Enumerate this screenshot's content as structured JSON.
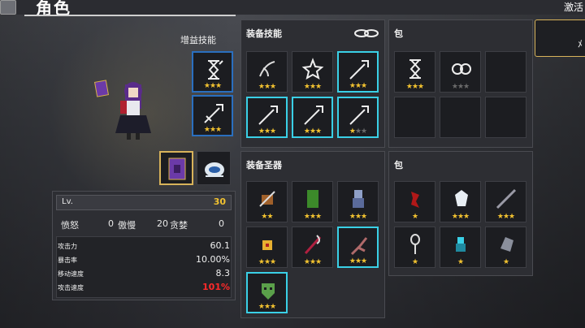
{
  "header": {
    "title": "角色",
    "activate": "激活"
  },
  "buff_skills": {
    "label": "增益技能"
  },
  "equip_skills": {
    "title": "装备技能"
  },
  "bag_top": {
    "title": "包"
  },
  "equip_relics": {
    "title": "装备圣器"
  },
  "bag_bottom": {
    "title": "包"
  },
  "stats": {
    "lv_label": "Lv.",
    "lv_value": "30",
    "anger_label": "愤怒",
    "anger_value": "0",
    "pride_label": "傲慢",
    "pride_value": "20",
    "greed_label": "贪婪",
    "greed_value": "0",
    "rows": [
      {
        "label": "攻击力",
        "value": "60.1"
      },
      {
        "label": "暴击率",
        "value": "10.00%"
      },
      {
        "label": "移动速度",
        "value": "8.3"
      },
      {
        "label": "攻击速度",
        "value": "101%"
      }
    ]
  },
  "colors": {
    "accent": "#3ad0e6",
    "gold": "#f2c230",
    "red": "#ff2a2a"
  }
}
